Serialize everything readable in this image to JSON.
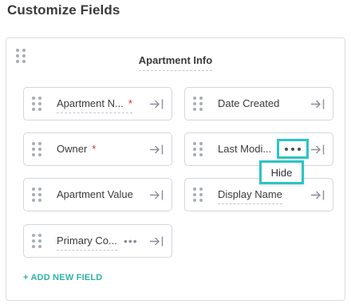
{
  "page": {
    "title": "Customize Fields"
  },
  "section": {
    "title": "Apartment Info"
  },
  "fields": [
    {
      "label": "Apartment N...",
      "required": "*"
    },
    {
      "label": "Date Created"
    },
    {
      "label": "Owner",
      "required": "*"
    },
    {
      "label": "Last Modi..."
    },
    {
      "label": "Apartment Value"
    },
    {
      "label": "Display Name"
    },
    {
      "label": "Primary Co..."
    }
  ],
  "menu": {
    "more": "•••",
    "hide_option": "Hide"
  },
  "actions": {
    "add_field": "+ ADD NEW FIELD"
  },
  "colors": {
    "accent": "#2cc4c4",
    "link": "#2fb3a6",
    "required": "#e02424"
  }
}
